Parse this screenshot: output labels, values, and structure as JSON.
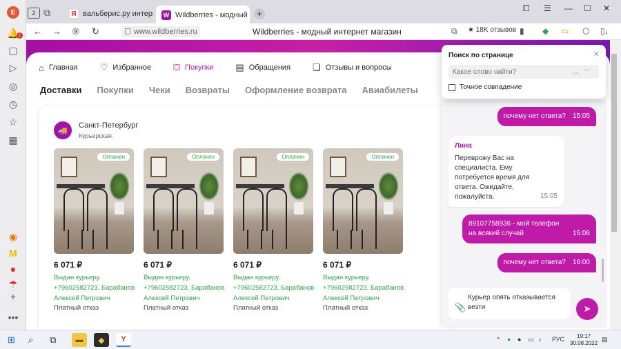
{
  "browser": {
    "profile_letter": "E",
    "tab_count": "2",
    "tabs": [
      {
        "label": "вальберис.ру интернет ма",
        "icon": "yandex-icon"
      },
      {
        "label": "Wildberries - модный и",
        "icon": "wb-icon"
      }
    ],
    "url": "www.wildberries.ru",
    "page_title": "Wildberries - модный интернет магазин",
    "reviews": "18K отзывов"
  },
  "wb": {
    "nav": [
      "Главная",
      "Избранное",
      "Покупки",
      "Обращения",
      "Отзывы и вопросы"
    ],
    "subnav": [
      "Доставки",
      "Покупки",
      "Чеки",
      "Возвраты",
      "Оформление возврата",
      "Авиабилеты"
    ],
    "delivery": {
      "city": "Санкт-Петербург",
      "method": "Курьерская.",
      "products": [
        {
          "badge": "Оплачен",
          "price": "6 071 ₽",
          "status_1": "Выдан курьеру.",
          "status_2": "+79602582723, Барабанов",
          "status_3": "Алексей Петрович",
          "refusal": "Платный отказ"
        },
        {
          "badge": "Оплачен",
          "price": "6 071 ₽",
          "status_1": "Выдан курьеру.",
          "status_2": "+79602582723, Барабанов",
          "status_3": "Алексей Петрович",
          "refusal": "Платный отказ"
        },
        {
          "badge": "Оплачен",
          "price": "6 071 ₽",
          "status_1": "Выдан курьеру.",
          "status_2": "+79602582723, Барабанов",
          "status_3": "Алексей Петрович",
          "refusal": "Платный отказ"
        },
        {
          "badge": "Оплачен",
          "price": "6 071 ₽",
          "status_1": "Выдан курьеру.",
          "status_2": "+79602582723, Барабанов",
          "status_3": "Алексей Петрович",
          "refusal": "Платный отказ"
        }
      ]
    }
  },
  "find": {
    "title": "Поиск по странице",
    "placeholder": "Какое слово найти?",
    "exact_match": "Точное совпадение"
  },
  "chat": {
    "msg1": {
      "text": "почему нет ответа?",
      "time": "15:05"
    },
    "msg2": {
      "author": "Лина",
      "text": "Переврожу Вас на специалиста. Ему потребуется время для ответа. Ожидайте, пожалуйста.",
      "time": "15:05"
    },
    "msg3": {
      "line1": "89107758936 - мой телефон",
      "line2": "на всякий случай",
      "time": "15:06"
    },
    "msg4": {
      "text": "почему нет ответа?",
      "time": "16:00"
    },
    "draft": "Курьер опять отказывается везти"
  },
  "taskbar": {
    "lang": "РУС",
    "time": "19:17",
    "date": "30.08.2022"
  },
  "colors": {
    "brand": "#c01aa8",
    "paid": "#2fa84a"
  }
}
